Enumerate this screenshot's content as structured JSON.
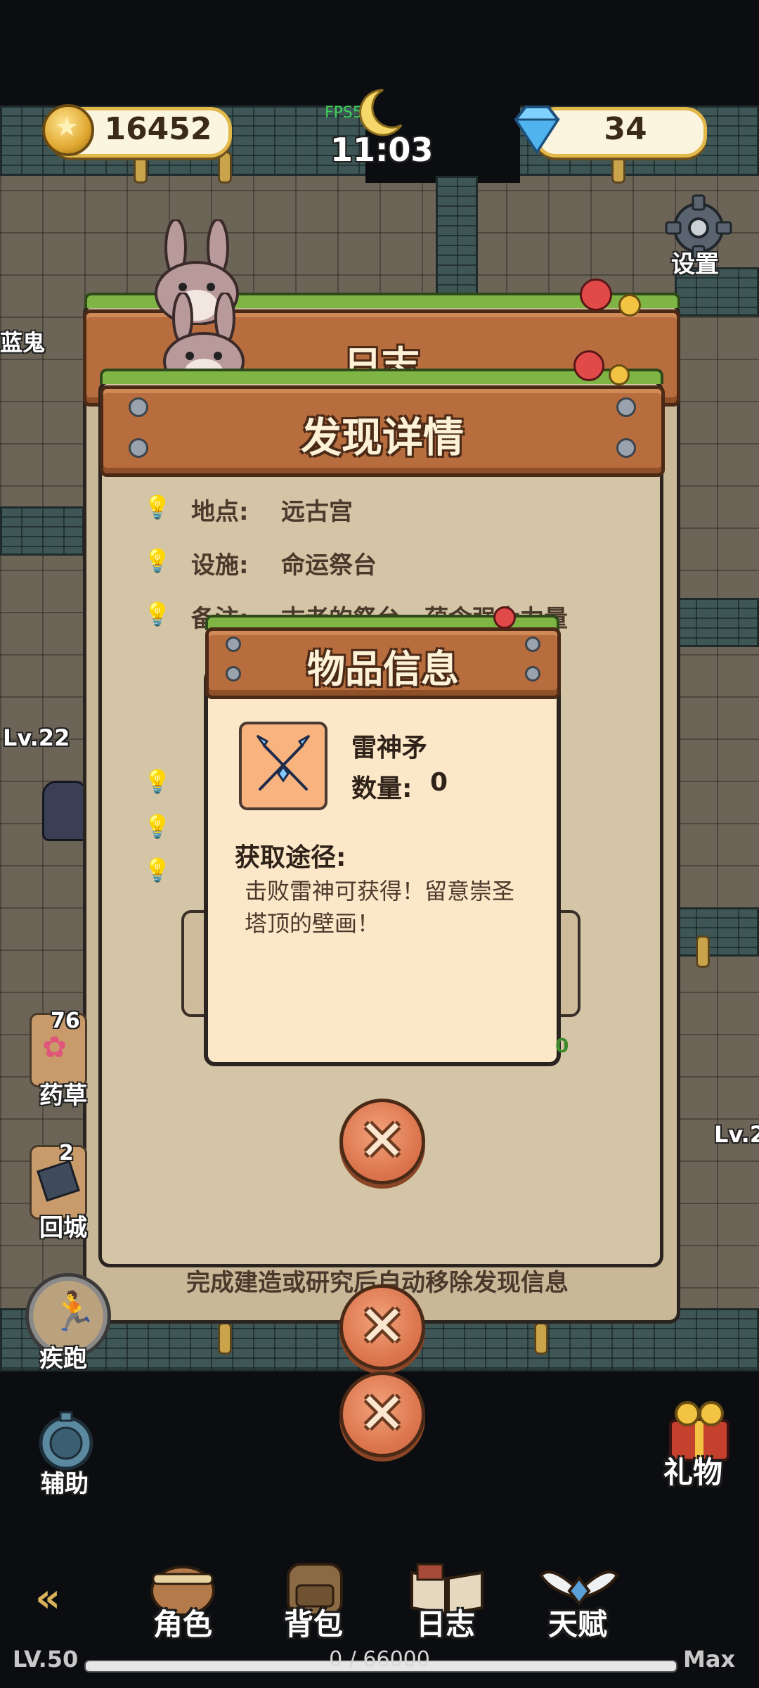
{
  "hud": {
    "coins": "16452",
    "fps": "FPS55",
    "time": "11:03",
    "gems": "34",
    "settings_label": "设置"
  },
  "background": {
    "enemy_name_left": "蓝鬼",
    "enemy_level_left": "Lv.22",
    "enemy_level_right": "Lv.2"
  },
  "journal": {
    "title": "日志",
    "footer": "完成建造或研究后自动移除发现信息"
  },
  "discovery": {
    "title": "发现详情",
    "rows": [
      {
        "label": "地点:",
        "value": "远古宫"
      },
      {
        "label": "设施:",
        "value": "命运祭台"
      },
      {
        "label": "备注:",
        "value": "古老的祭台，蕴含强大力量"
      }
    ]
  },
  "item_info": {
    "title": "物品信息",
    "item_name": "雷神矛",
    "quantity_label": "数量:",
    "quantity": "0",
    "source_title": "获取途径:",
    "source_text": "击败雷神可获得！留意崇圣塔顶的壁画！"
  },
  "side": {
    "herb_count": "76",
    "herb_label": "药草",
    "return_count": "2",
    "return_label": "回城",
    "sprint_label": "疾跑",
    "assist_label": "辅助",
    "gift_label": "礼物"
  },
  "nav": {
    "items": [
      {
        "label": "角色",
        "icon": "character-icon"
      },
      {
        "label": "背包",
        "icon": "backpack-icon"
      },
      {
        "label": "日志",
        "icon": "journal-book-icon"
      },
      {
        "label": "天赋",
        "icon": "talent-wings-icon"
      }
    ]
  },
  "xp": {
    "level": "LV.50",
    "progress": "0 / 66000",
    "max_label": "Max",
    "fraction": 0
  }
}
